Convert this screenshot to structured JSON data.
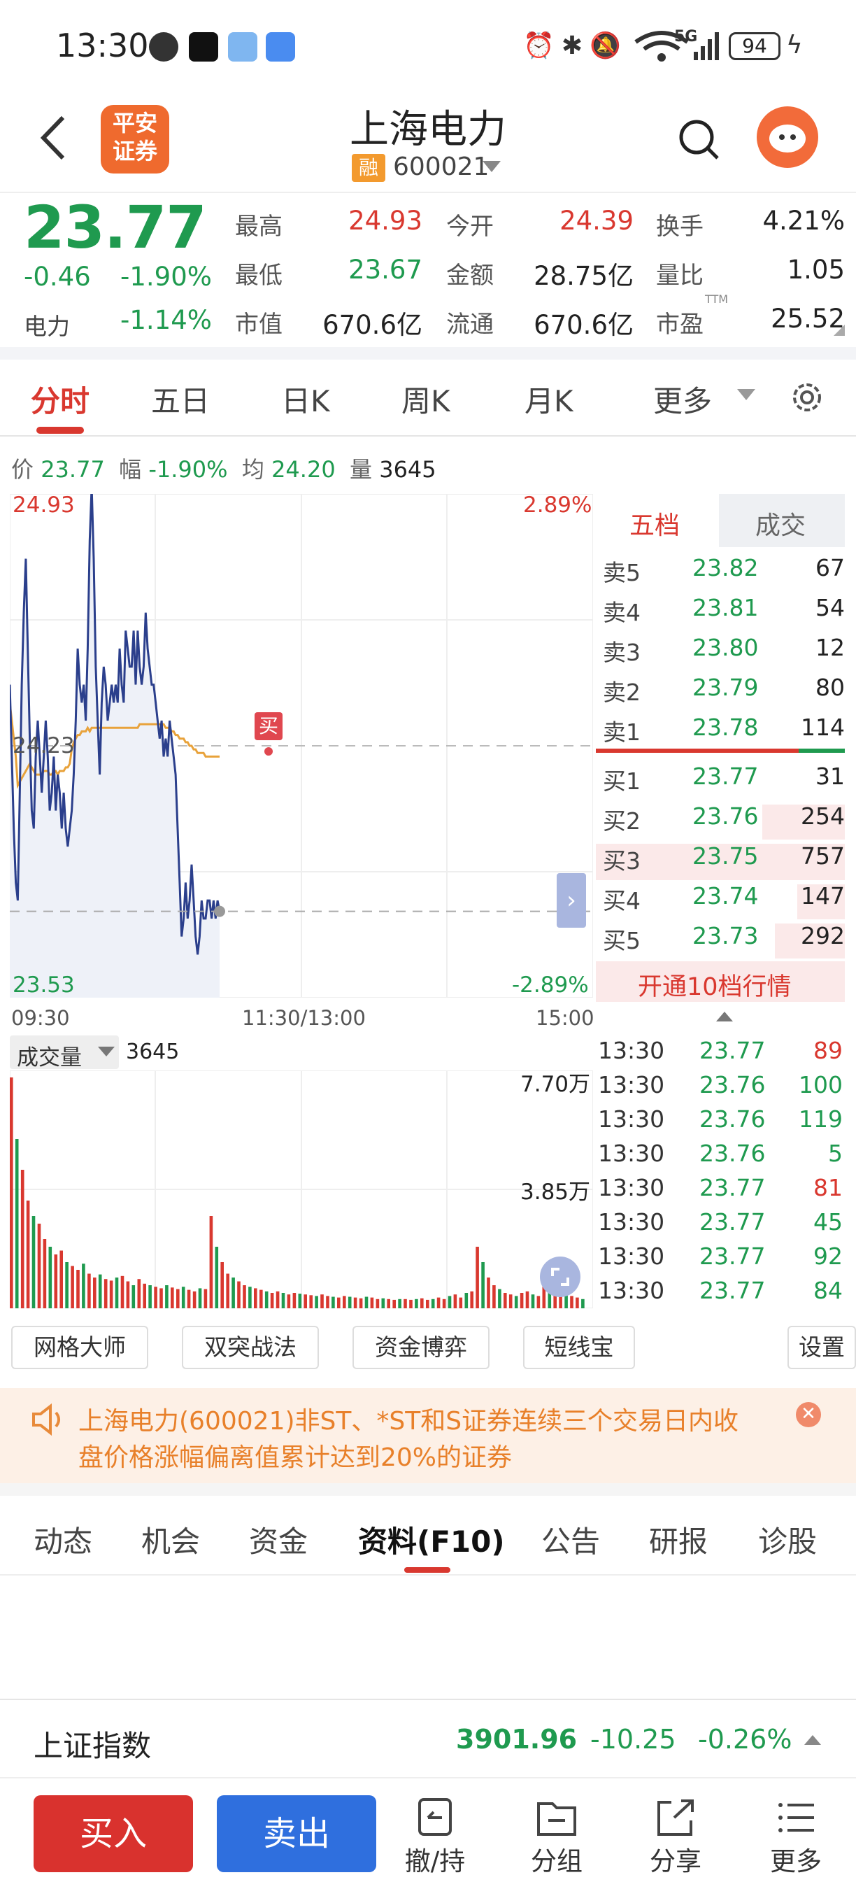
{
  "status_bar": {
    "time": "13:30",
    "battery": "94",
    "network": "5G"
  },
  "header": {
    "title": "上海电力",
    "code": "600021",
    "margin_badge": "融",
    "broker_logo_text": "平安证券"
  },
  "quote": {
    "price": "23.77",
    "change": "-0.46",
    "change_pct": "-1.90%",
    "sector_label": "电力",
    "sector_change": "-1.14%",
    "stats": [
      {
        "label": "最高",
        "value": "24.93"
      },
      {
        "label": "今开",
        "value": "24.39"
      },
      {
        "label": "换手",
        "value": "4.21%"
      },
      {
        "label": "最低",
        "value": "23.67"
      },
      {
        "label": "金额",
        "value": "28.75亿"
      },
      {
        "label": "量比",
        "value": "1.05"
      },
      {
        "label": "市值",
        "value": "670.6亿"
      },
      {
        "label": "流通",
        "value": "670.6亿"
      },
      {
        "label": "市盈",
        "value": "25.52",
        "sup": "TTM"
      }
    ]
  },
  "chart_tabs": [
    "分时",
    "五日",
    "日K",
    "周K",
    "月K",
    "更多"
  ],
  "info_line": {
    "price_label": "价",
    "price": "23.77",
    "amp_label": "幅",
    "amp": "-1.90%",
    "avg_label": "均",
    "avg": "24.20",
    "vol_label": "量",
    "vol": "3645"
  },
  "chart_labels": {
    "top_left": "24.93",
    "top_right": "2.89%",
    "mid_left": "24.23",
    "bottom_left": "23.53",
    "bottom_right": "-2.89%",
    "t_start": "09:30",
    "t_mid": "11:30/13:00",
    "t_end": "15:00",
    "buy_marker": "买"
  },
  "volume": {
    "selector": "成交量",
    "value": "3645",
    "tick_high": "7.70万",
    "tick_mid": "3.85万"
  },
  "order_book": {
    "tabs": [
      "五档",
      "成交"
    ],
    "asks": [
      {
        "label": "卖5",
        "price": "23.82",
        "vol": "67"
      },
      {
        "label": "卖4",
        "price": "23.81",
        "vol": "54"
      },
      {
        "label": "卖3",
        "price": "23.80",
        "vol": "12"
      },
      {
        "label": "卖2",
        "price": "23.79",
        "vol": "80"
      },
      {
        "label": "卖1",
        "price": "23.78",
        "vol": "114"
      }
    ],
    "bids": [
      {
        "label": "买1",
        "price": "23.77",
        "vol": "31"
      },
      {
        "label": "买2",
        "price": "23.76",
        "vol": "254"
      },
      {
        "label": "买3",
        "price": "23.75",
        "vol": "757"
      },
      {
        "label": "买4",
        "price": "23.74",
        "vol": "147"
      },
      {
        "label": "买5",
        "price": "23.73",
        "vol": "292"
      }
    ],
    "upgrade": "开通10档行情"
  },
  "ticks": [
    {
      "time": "13:30",
      "price": "23.77",
      "vol": "89",
      "dir": "up"
    },
    {
      "time": "13:30",
      "price": "23.76",
      "vol": "100",
      "dir": "down"
    },
    {
      "time": "13:30",
      "price": "23.76",
      "vol": "119",
      "dir": "down"
    },
    {
      "time": "13:30",
      "price": "23.76",
      "vol": "5",
      "dir": "down"
    },
    {
      "time": "13:30",
      "price": "23.77",
      "vol": "81",
      "dir": "up"
    },
    {
      "time": "13:30",
      "price": "23.77",
      "vol": "45",
      "dir": "down"
    },
    {
      "time": "13:30",
      "price": "23.77",
      "vol": "92",
      "dir": "down"
    },
    {
      "time": "13:30",
      "price": "23.77",
      "vol": "84",
      "dir": "down"
    }
  ],
  "tools": [
    "网格大师",
    "双突战法",
    "资金博弈",
    "短线宝",
    "设置"
  ],
  "notice": {
    "line1": "上海电力(600021)非ST、*ST和S证券连续三个交易日内收",
    "line2": "盘价格涨幅偏离值累计达到20%的证券"
  },
  "feature_tabs": [
    "动态",
    "机会",
    "资金",
    "资料(F10)",
    "公告",
    "研报",
    "诊股"
  ],
  "index_bar": {
    "name": "上证指数",
    "value": "3901.96",
    "change": "-10.25",
    "change_pct": "-0.26%"
  },
  "bottom_bar": {
    "buy": "买入",
    "sell": "卖出",
    "items": [
      "撤/持",
      "分组",
      "分享",
      "更多"
    ]
  },
  "colors": {
    "up": "#d9382f",
    "down": "#1f9a4f",
    "price_line": "#2b3f8c",
    "avg_line": "#e8a23a",
    "buy_button": "#d9322e",
    "sell_button": "#2f6fde"
  },
  "chart_data": {
    "type": "line",
    "title": "",
    "xlabel": "",
    "ylabel": "",
    "x_ticks": [
      "09:30",
      "11:30/13:00",
      "15:00"
    ],
    "ylim": [
      23.53,
      24.93
    ],
    "y_ticks": [
      "24.93",
      "24.23",
      "23.53"
    ],
    "y_right_ticks": [
      "2.89%",
      "-2.89%"
    ],
    "series": [
      {
        "values": [
          24.4,
          24.2,
          24.0,
          23.85,
          23.8,
          24.1,
          24.4,
          24.6,
          24.75,
          24.5,
          24.25,
          24.05,
          24.0,
          24.2,
          24.3,
          24.2,
          24.1,
          24.2,
          24.3,
          24.2,
          24.05,
          24.1,
          24.2,
          24.05,
          24.15,
          24.1,
          24.0,
          24.1,
          24.0,
          23.95,
          24.0,
          24.05,
          24.15,
          24.3,
          24.5,
          24.4,
          24.35,
          24.4,
          24.3,
          24.5,
          24.8,
          24.95,
          24.75,
          24.45,
          24.3,
          24.15,
          24.35,
          24.45,
          24.4,
          24.3,
          24.35,
          24.4,
          24.35,
          24.4,
          24.35,
          24.5,
          24.4,
          24.35,
          24.55,
          24.5,
          24.45,
          24.45,
          24.55,
          24.4,
          24.55,
          24.45,
          24.4,
          24.45,
          24.6,
          24.5,
          24.45,
          24.4,
          24.4,
          24.35,
          24.3,
          24.25,
          24.3,
          24.2,
          24.25,
          24.2,
          24.3,
          24.25,
          24.2,
          24.15,
          24.0,
          23.85,
          23.7,
          23.75,
          23.85,
          23.75,
          23.8,
          23.9,
          23.8,
          23.7,
          23.65,
          23.7,
          23.8,
          23.75,
          23.75,
          23.8,
          23.8,
          23.75,
          23.8,
          23.75,
          23.8,
          23.77
        ]
      },
      {
        "values": [
          24.35,
          24.3,
          24.25,
          24.2,
          24.12,
          24.13,
          24.14,
          24.15,
          24.16,
          24.17,
          24.18,
          24.17,
          24.16,
          24.15,
          24.15,
          24.15,
          24.15,
          24.16,
          24.16,
          24.16,
          24.15,
          24.15,
          24.16,
          24.16,
          24.15,
          24.16,
          24.16,
          24.16,
          24.17,
          24.17,
          24.18,
          24.22,
          24.24,
          24.25,
          24.26,
          24.26,
          24.27,
          24.27,
          24.27,
          24.28,
          24.27,
          24.28,
          24.28,
          24.28,
          24.28,
          24.28,
          24.28,
          24.28,
          24.28,
          24.28,
          24.28,
          24.28,
          24.28,
          24.28,
          24.28,
          24.28,
          24.28,
          24.28,
          24.28,
          24.28,
          24.28,
          24.28,
          24.28,
          24.28,
          24.28,
          24.29,
          24.29,
          24.29,
          24.29,
          24.29,
          24.29,
          24.29,
          24.29,
          24.29,
          24.29,
          24.29,
          24.29,
          24.29,
          24.28,
          24.28,
          24.28,
          24.27,
          24.27,
          24.26,
          24.26,
          24.25,
          24.25,
          24.25,
          24.24,
          24.24,
          24.23,
          24.23,
          24.22,
          24.22,
          24.21,
          24.21,
          24.21,
          24.21,
          24.2,
          24.2,
          24.2,
          24.2,
          24.2,
          24.2,
          24.2,
          24.2
        ]
      }
    ],
    "prev_close": 24.23
  }
}
